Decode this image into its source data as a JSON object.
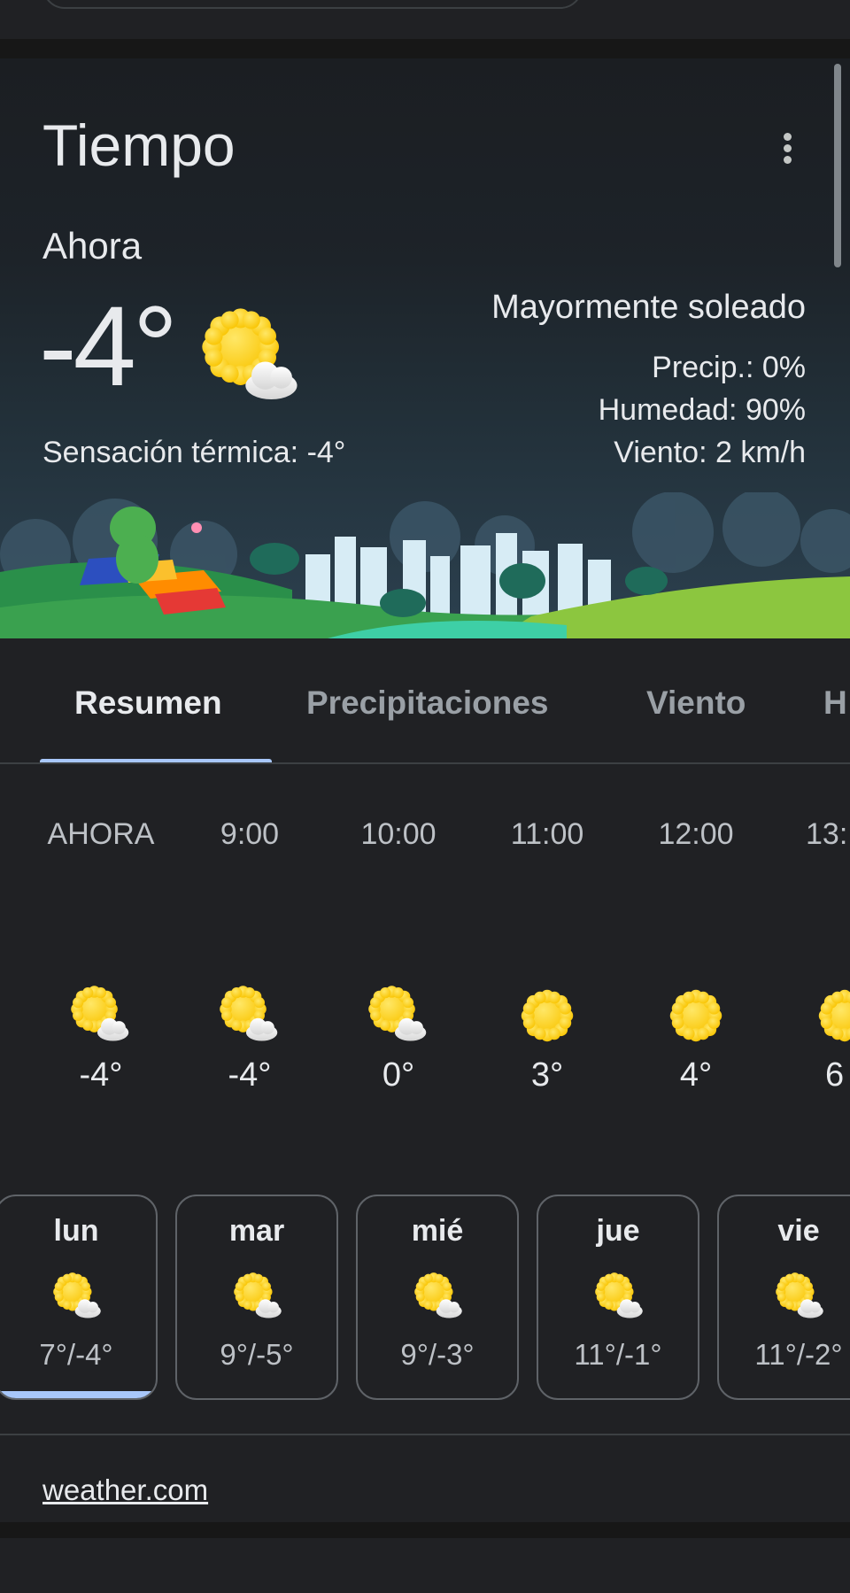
{
  "card": {
    "title": "Tiempo",
    "now_label": "Ahora",
    "current_temp": "-4°",
    "feels_like": "Sensación térmica: -4°",
    "condition": "Mayormente soleado",
    "precip": "Precip.: 0%",
    "humidity": "Humedad: 90%",
    "wind": "Viento: 2 km/h",
    "current_icon": "mostly-sunny-icon"
  },
  "tabs": [
    {
      "label": "Resumen",
      "active": true
    },
    {
      "label": "Precipitaciones",
      "active": false
    },
    {
      "label": "Viento",
      "active": false
    },
    {
      "label": "H",
      "active": false
    }
  ],
  "hourly": [
    {
      "time": "AHORA",
      "temp": "-4°",
      "icon": "mostly-sunny-icon"
    },
    {
      "time": "9:00",
      "temp": "-4°",
      "icon": "mostly-sunny-icon"
    },
    {
      "time": "10:00",
      "temp": "0°",
      "icon": "mostly-sunny-icon"
    },
    {
      "time": "11:00",
      "temp": "3°",
      "icon": "sunny-icon"
    },
    {
      "time": "12:00",
      "temp": "4°",
      "icon": "sunny-icon"
    },
    {
      "time": "13:",
      "temp": "6",
      "icon": "sunny-icon"
    }
  ],
  "daily": [
    {
      "day": "lun",
      "range": "7°/-4°",
      "icon": "mostly-sunny-icon",
      "selected": true
    },
    {
      "day": "mar",
      "range": "9°/-5°",
      "icon": "mostly-sunny-icon",
      "selected": false
    },
    {
      "day": "mié",
      "range": "9°/-3°",
      "icon": "mostly-sunny-icon",
      "selected": false
    },
    {
      "day": "jue",
      "range": "11°/-1°",
      "icon": "mostly-sunny-icon",
      "selected": false
    },
    {
      "day": "vie",
      "range": "11°/-2°",
      "icon": "mostly-sunny-icon",
      "selected": false
    }
  ],
  "source": "weather.com",
  "colors": {
    "background": "#202124",
    "accent": "#a8c7fa",
    "sun": "#fdd835"
  }
}
